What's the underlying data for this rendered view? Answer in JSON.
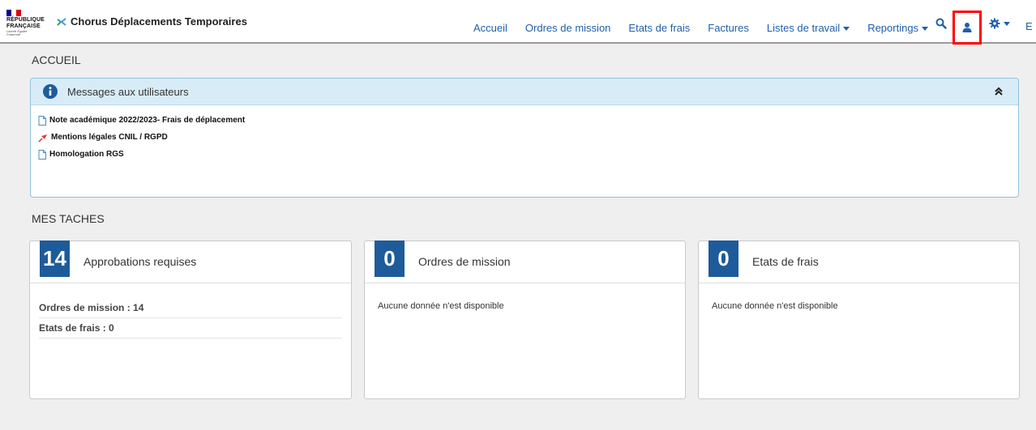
{
  "header": {
    "rf_logo": {
      "line1": "RÉPUBLIQUE",
      "line2": "FRANÇAISE",
      "motto": "Liberté Égalité Fraternité"
    },
    "brand": "Chorus Déplacements Temporaires",
    "nav": [
      {
        "label": "Accueil",
        "dropdown": false
      },
      {
        "label": "Ordres de mission",
        "dropdown": false
      },
      {
        "label": "Etats de frais",
        "dropdown": false
      },
      {
        "label": "Factures",
        "dropdown": false
      },
      {
        "label": "Listes de travail",
        "dropdown": true
      },
      {
        "label": "Reportings",
        "dropdown": true
      }
    ],
    "icons": {
      "search": "search-icon",
      "user": "user-icon",
      "settings": "gear-icon"
    },
    "cut_item": "E",
    "highlight_color": "#ff0000"
  },
  "accueil": {
    "title": "ACCUEIL",
    "messages": {
      "title": "Messages aux utilisateurs",
      "items": [
        {
          "label": "Note académique 2022/2023- Frais de déplacement",
          "icon": "document-icon"
        },
        {
          "label": "Mentions légales CNIL / RGPD",
          "icon": "pushpin-icon"
        },
        {
          "label": "Homologation RGS",
          "icon": "document-icon"
        }
      ]
    }
  },
  "taches": {
    "title": "MES TACHES",
    "cards": [
      {
        "count": "14",
        "title": "Approbations requises",
        "rows": [
          "Ordres de mission : 14",
          "Etats de frais : 0"
        ]
      },
      {
        "count": "0",
        "title": "Ordres de mission",
        "empty": "Aucune donnée n'est disponible"
      },
      {
        "count": "0",
        "title": "Etats de frais",
        "empty": "Aucune donnée n'est disponible"
      }
    ]
  },
  "colors": {
    "accent": "#1f5fa8",
    "badge": "#1e5b9a",
    "info_bg": "#d8ecf7"
  }
}
